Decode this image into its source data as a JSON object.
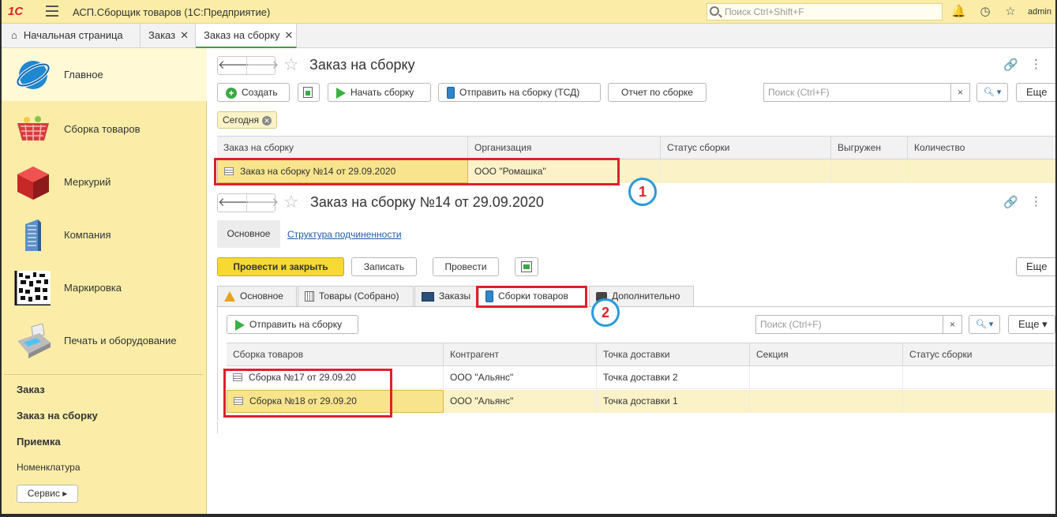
{
  "app": {
    "title": "АСП.Сборщик товаров  (1С:Предприятие)",
    "logo": "1С",
    "search_placeholder": "Поиск Ctrl+Shift+F",
    "user": "admin",
    "icons": [
      "bell-icon",
      "history-icon",
      "star-icon"
    ]
  },
  "tabs": [
    {
      "label": "Начальная страница",
      "closable": false
    },
    {
      "label": "Заказ",
      "closable": true
    },
    {
      "label": "Заказ на сборку",
      "closable": true
    }
  ],
  "sidebar": {
    "sections": [
      {
        "label": "Главное"
      },
      {
        "label": "Сборка товаров"
      },
      {
        "label": "Меркурий"
      },
      {
        "label": "Компания"
      },
      {
        "label": "Маркировка"
      },
      {
        "label": "Печать и оборудование"
      }
    ],
    "links": [
      {
        "label": "Заказ",
        "bold": true
      },
      {
        "label": "Заказ на сборку",
        "bold": true
      },
      {
        "label": "Приемка",
        "bold": true
      },
      {
        "label": "Номенклатура",
        "bold": false
      }
    ],
    "service_label": "Сервис ▸"
  },
  "list": {
    "title": "Заказ на сборку",
    "toolbar": {
      "create": "Создать",
      "start": "Начать сборку",
      "send_tsd": "Отправить на сборку (ТСД)",
      "report": "Отчет по сборке",
      "search_placeholder": "Поиск (Ctrl+F)",
      "more": "Еще"
    },
    "filter_chip": "Сегодня",
    "columns": [
      "Заказ на сборку",
      "Организация",
      "Статус сборки",
      "Выгружен",
      "Количество"
    ],
    "rows": [
      {
        "order": "Заказ на сборку №14 от 29.09.2020",
        "org": "ООО \"Ромашка\"",
        "status": "",
        "exported": "",
        "qty": ""
      }
    ],
    "badge": "1"
  },
  "form": {
    "title": "Заказ на сборку №14 от 29.09.2020",
    "nav": {
      "main": "Основное",
      "structure": "Структура подчиненности"
    },
    "buttons": {
      "post_close": "Провести и закрыть",
      "save": "Записать",
      "post": "Провести",
      "more": "Еще"
    },
    "tabs": [
      "Основное",
      "Товары (Собрано)",
      "Заказы",
      "Сборки товаров",
      "Дополнительно"
    ],
    "badge": "2",
    "sub": {
      "send": "Отправить на сборку",
      "search_placeholder": "Поиск (Ctrl+F)",
      "more": "Еще",
      "columns": [
        "Сборка товаров",
        "Контрагент",
        "Точка доставки",
        "Секция",
        "Статус сборки"
      ],
      "rows": [
        {
          "assembly": "Сборка №17 от 29.09.20",
          "counterparty": "ООО \"Альянс\"",
          "point": "Точка  доставки 2",
          "section": "",
          "status": ""
        },
        {
          "assembly": "Сборка №18 от 29.09.20",
          "counterparty": "ООО \"Альянс\"",
          "point": "Точка  доставки 1",
          "section": "",
          "status": ""
        }
      ]
    }
  }
}
